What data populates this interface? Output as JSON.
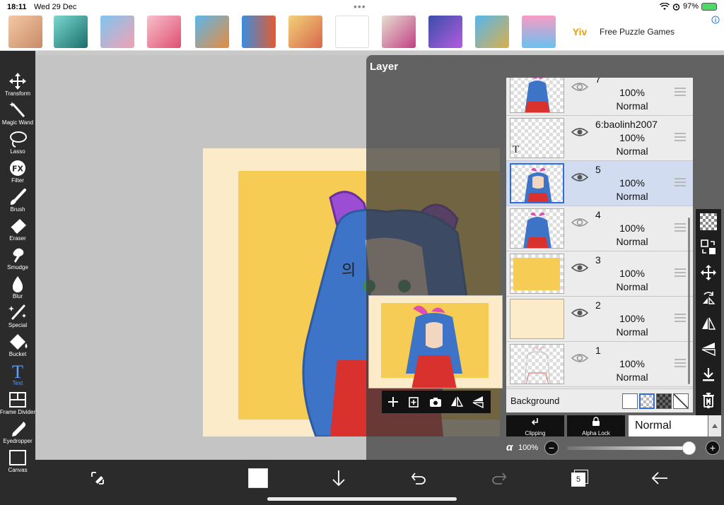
{
  "status_bar": {
    "time": "18:11",
    "date": "Wed 29 Dec",
    "battery": "97%"
  },
  "ad": {
    "brand": "Yiv",
    "text": "Free Puzzle Games"
  },
  "tools": [
    {
      "label": "Transform",
      "icon": "transform-icon"
    },
    {
      "label": "Magic Wand",
      "icon": "magic-wand-icon"
    },
    {
      "label": "Lasso",
      "icon": "lasso-icon"
    },
    {
      "label": "Filter",
      "icon": "filter-icon"
    },
    {
      "label": "Brush",
      "icon": "brush-icon"
    },
    {
      "label": "Eraser",
      "icon": "eraser-icon"
    },
    {
      "label": "Smudge",
      "icon": "smudge-icon"
    },
    {
      "label": "Blur",
      "icon": "blur-icon"
    },
    {
      "label": "Special",
      "icon": "special-icon"
    },
    {
      "label": "Bucket",
      "icon": "bucket-icon"
    },
    {
      "label": "Text",
      "icon": "text-icon"
    },
    {
      "label": "Frame Divider",
      "icon": "frame-divider-icon"
    },
    {
      "label": "Eyedropper",
      "icon": "eyedropper-icon"
    },
    {
      "label": "Canvas",
      "icon": "canvas-icon"
    }
  ],
  "active_tool": "Text",
  "layer_panel": {
    "title": "Layer",
    "layers": [
      {
        "name": "7",
        "opacity": "100%",
        "blend": "Normal",
        "selected": false
      },
      {
        "name": "6:baolinh2007",
        "opacity": "100%",
        "blend": "Normal",
        "selected": false
      },
      {
        "name": "5",
        "opacity": "100%",
        "blend": "Normal",
        "selected": true
      },
      {
        "name": "4",
        "opacity": "100%",
        "blend": "Normal",
        "selected": false
      },
      {
        "name": "3",
        "opacity": "100%",
        "blend": "Normal",
        "selected": false
      },
      {
        "name": "2",
        "opacity": "100%",
        "blend": "Normal",
        "selected": false
      },
      {
        "name": "1",
        "opacity": "100%",
        "blend": "Normal",
        "selected": false
      }
    ],
    "background_label": "Background",
    "clipping_label": "Clipping",
    "alpha_lock_label": "Alpha Lock",
    "blend_mode": "Normal",
    "alpha_symbol": "α",
    "alpha_value": "100%",
    "opacity_fraction": 1.0
  },
  "bottom_bar": {
    "layer_count": "5"
  },
  "colors": {
    "toolbar_bg": "#2b2b2b",
    "accent": "#2e6de0",
    "active_tool": "#5aa0ff",
    "artwork_bg": "#fcebc8",
    "artwork_yellow": "#f7cc55"
  }
}
